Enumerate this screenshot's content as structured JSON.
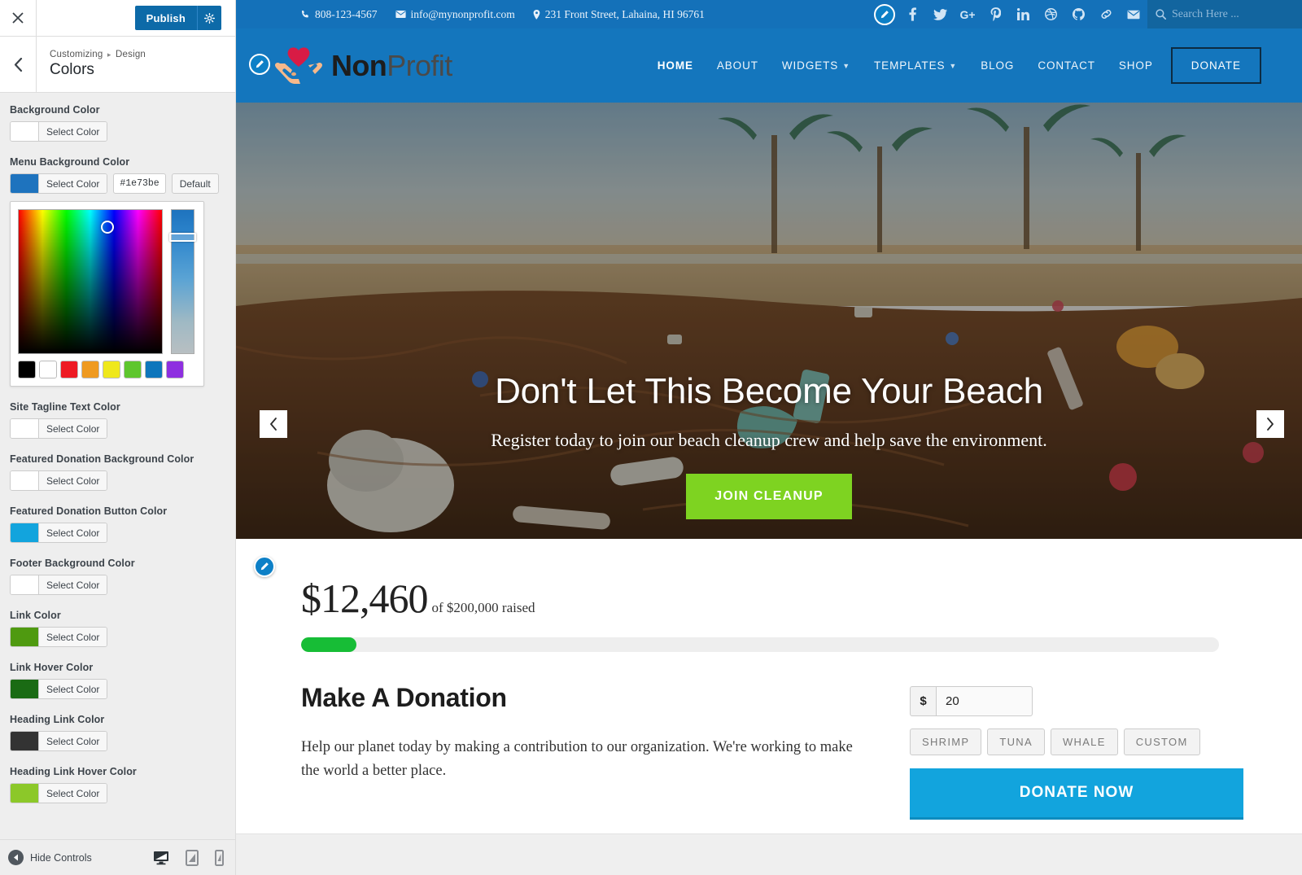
{
  "customizer": {
    "close_label": "×",
    "publish_label": "Publish",
    "gear_icon": "gear-icon",
    "back_icon": "chevron-left-icon",
    "breadcrumb_root": "Customizing",
    "breadcrumb_sep": "▸",
    "breadcrumb_section": "Design",
    "panel_title": "Colors",
    "controls": [
      {
        "label": "Background Color",
        "button_label": "Select Color",
        "swatch": "#ffffff",
        "has_picker": false
      },
      {
        "label": "Menu Background Color",
        "button_label": "Select Color",
        "swatch": "#1e73be",
        "hex_value": "#1e73be",
        "default_label": "Default",
        "has_picker": true
      },
      {
        "label": "Site Tagline Text Color",
        "button_label": "Select Color",
        "swatch": "#ffffff",
        "has_picker": false
      },
      {
        "label": "Featured Donation Background Color",
        "button_label": "Select Color",
        "swatch": "#ffffff",
        "has_picker": false
      },
      {
        "label": "Featured Donation Button Color",
        "button_label": "Select Color",
        "swatch": "#12a4dd",
        "has_picker": false
      },
      {
        "label": "Footer Background Color",
        "button_label": "Select Color",
        "swatch": "#ffffff",
        "has_picker": false
      },
      {
        "label": "Link Color",
        "button_label": "Select Color",
        "swatch": "#4f9a10",
        "has_picker": false
      },
      {
        "label": "Link Hover Color",
        "button_label": "Select Color",
        "swatch": "#1a6b14",
        "has_picker": false
      },
      {
        "label": "Heading Link Color",
        "button_label": "Select Color",
        "swatch": "#333333",
        "has_picker": false
      },
      {
        "label": "Heading Link Hover Color",
        "button_label": "Select Color",
        "swatch": "#8cc829",
        "has_picker": false
      }
    ],
    "picker": {
      "palette": [
        "#000000",
        "#ffffff",
        "#ee1b24",
        "#ef9a20",
        "#efe81c",
        "#5ec62e",
        "#0e76bc",
        "#8e2fe0"
      ],
      "selected_hue": "#1e73be"
    },
    "footer": {
      "hide_controls_label": "Hide Controls",
      "hide_icon": "collapse-arrow-icon",
      "devices": [
        {
          "name": "desktop-preview-icon",
          "active": true
        },
        {
          "name": "tablet-preview-icon",
          "active": false
        },
        {
          "name": "mobile-preview-icon",
          "active": false
        }
      ]
    }
  },
  "site": {
    "topbar": {
      "phone": "808-123-4567",
      "email": "info@mynonprofit.com",
      "address": "231 Front Street, Lahaina, HI 96761",
      "social": [
        {
          "name": "facebook-icon",
          "glyph": "f"
        },
        {
          "name": "twitter-icon",
          "glyph": "t"
        },
        {
          "name": "google-plus-icon",
          "glyph": "G+"
        },
        {
          "name": "pinterest-icon",
          "glyph": "P"
        },
        {
          "name": "linkedin-icon",
          "glyph": "in"
        },
        {
          "name": "dribbble-icon",
          "glyph": "d"
        },
        {
          "name": "github-icon",
          "glyph": "gh"
        },
        {
          "name": "link-icon",
          "glyph": "%"
        },
        {
          "name": "email-icon",
          "glyph": "@"
        }
      ],
      "search_placeholder": "Search Here ..."
    },
    "brand": {
      "name_bold": "Non",
      "name_light": "Profit",
      "logo_icon": "hands-heart-logo"
    },
    "nav": [
      {
        "label": "HOME",
        "active": true,
        "has_dropdown": false
      },
      {
        "label": "ABOUT",
        "active": false,
        "has_dropdown": false
      },
      {
        "label": "WIDGETS",
        "active": false,
        "has_dropdown": true
      },
      {
        "label": "TEMPLATES",
        "active": false,
        "has_dropdown": true
      },
      {
        "label": "BLOG",
        "active": false,
        "has_dropdown": false
      },
      {
        "label": "CONTACT",
        "active": false,
        "has_dropdown": false
      },
      {
        "label": "SHOP",
        "active": false,
        "has_dropdown": false
      }
    ],
    "donate_nav_label": "DONATE",
    "hero": {
      "title": "Don't Let This Become Your Beach",
      "subtitle": "Register today to join our beach cleanup crew and help save the environment.",
      "cta_label": "JOIN CLEANUP",
      "cta_color": "#7ed321",
      "prev_icon": "chevron-left-icon",
      "next_icon": "chevron-right-icon"
    },
    "donation": {
      "raised_amount": "$12,460",
      "raised_of": "of $200,000 raised",
      "progress_percent": 6,
      "progress_color": "#17bd36",
      "heading": "Make A Donation",
      "body": "Help our planet today by making a contribution to our organization. We're working to make the world a better place.",
      "currency_symbol": "$",
      "amount_value": "20",
      "tiers": [
        "SHRIMP",
        "TUNA",
        "WHALE",
        "CUSTOM"
      ],
      "donate_button_label": "DONATE NOW",
      "donate_button_color": "#12a4dd"
    }
  }
}
